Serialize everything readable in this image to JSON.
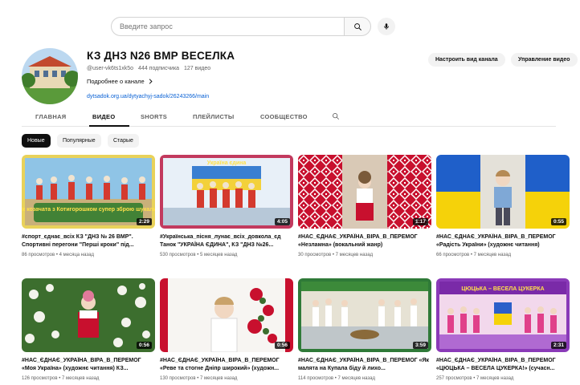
{
  "search": {
    "placeholder": "Введите запрос"
  },
  "channel": {
    "name": "КЗ ДНЗ N26 ВМР ВЕСЕЛКА",
    "handle": "@user-vk6ts1xk5o",
    "subscribers": "444 подписчика",
    "videos_count": "127 видео",
    "about": "Подробнее о канале",
    "link": "dytsadok.org.ua/dytyachyj-sadok/26243266/main"
  },
  "actions": {
    "customize": "Настроить вид канала",
    "manage": "Управление видео"
  },
  "tabs": [
    "ГЛАВНАЯ",
    "ВИДЕО",
    "SHORTS",
    "ПЛЕЙЛИСТЫ",
    "СООБЩЕСТВО"
  ],
  "chips": [
    "Новые",
    "Популярные",
    "Старые"
  ],
  "videos": [
    {
      "title": "#спорт_єднає_всіх КЗ \"ДНЗ № 26 ВМР\". Спортивні перегони \"Перші кроки\" під...",
      "meta": "86 просмотров • 4 месяца назад",
      "duration": "2:29",
      "overlay": "Як козачата з Котигорошком супер зброю шукали!"
    },
    {
      "title": "#Українська_пісня_лунає_всіх_довкола_єд Танок \"УКРАЇНА ЄДИНА\", КЗ \"ДНЗ №26...",
      "meta": "530 просмотров • 5 месяцев назад",
      "duration": "4:05",
      "overlay": "Україна єдина"
    },
    {
      "title": "#НАС_ЄДНАЄ_УКРАЇНА_ВІРА_В_ПЕРЕМОГ «Незламна» (вокальний жанр)",
      "meta": "30 просмотров • 7 месяцев назад",
      "duration": "1:17"
    },
    {
      "title": "#НАС_ЄДНАЄ_УКРАЇНА_ВІРА_В_ПЕРЕМОГ «Радість України» (художнє читання)",
      "meta": "66 просмотров • 7 месяцев назад",
      "duration": "0:55"
    },
    {
      "title": "#НАС_ЄДНАЄ_УКРАЇНА_ВІРА_В_ПЕРЕМОГ «Моя Україна» (художнє читання) КЗ...",
      "meta": "126 просмотров • 7 месяцев назад",
      "duration": "0:56"
    },
    {
      "title": "#НАС_ЄДНАЄ_УКРАЇНА_ВІРА_В_ПЕРЕМОГ «Реве та стогне Дніпр широкий» (художн...",
      "meta": "130 просмотров • 7 месяцев назад",
      "duration": "0:56"
    },
    {
      "title": "#НАС_ЄДНАЄ_УКРАЇНА_ВІРА_В_ПЕРЕМОГ «Як малята на Купала біду й лихо...",
      "meta": "114 просмотров • 7 месяцев назад",
      "duration": "3:59"
    },
    {
      "title": "#НАС_ЄДНАЄ_УКРАЇНА_ВІРА_В_ПЕРЕМОГ «ЦЮЦЬКА – ВЕСЕЛА ЦУКЕРКА!» (сучасн...",
      "meta": "257 просмотров • 7 месяцев назад",
      "duration": "2:31",
      "overlay": "ЦЮЦЬКА – ВЕСЕЛА ЦУКЕРКА"
    }
  ]
}
